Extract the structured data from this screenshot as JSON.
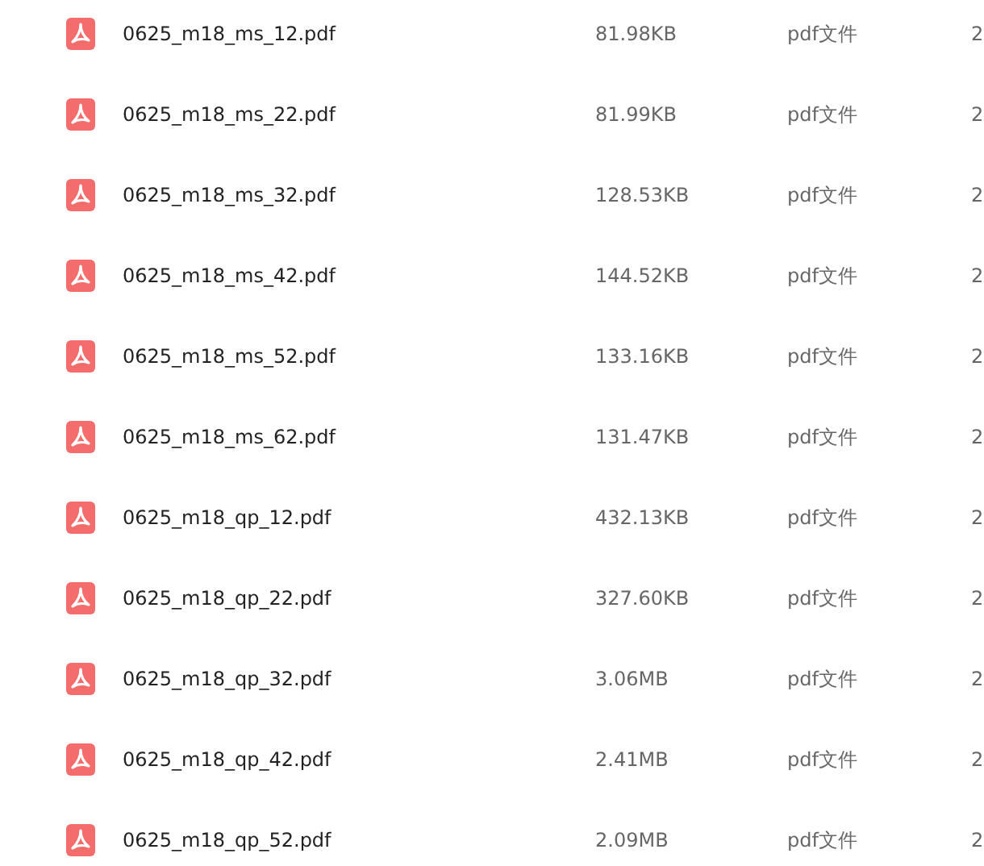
{
  "files": [
    {
      "name": "0625_m18_ms_12.pdf",
      "size": "81.98KB",
      "type": "pdf文件",
      "column_4": "2"
    },
    {
      "name": "0625_m18_ms_22.pdf",
      "size": "81.99KB",
      "type": "pdf文件",
      "column_4": "2"
    },
    {
      "name": "0625_m18_ms_32.pdf",
      "size": "128.53KB",
      "type": "pdf文件",
      "column_4": "2"
    },
    {
      "name": "0625_m18_ms_42.pdf",
      "size": "144.52KB",
      "type": "pdf文件",
      "column_4": "2"
    },
    {
      "name": "0625_m18_ms_52.pdf",
      "size": "133.16KB",
      "type": "pdf文件",
      "column_4": "2"
    },
    {
      "name": "0625_m18_ms_62.pdf",
      "size": "131.47KB",
      "type": "pdf文件",
      "column_4": "2"
    },
    {
      "name": "0625_m18_qp_12.pdf",
      "size": "432.13KB",
      "type": "pdf文件",
      "column_4": "2"
    },
    {
      "name": "0625_m18_qp_22.pdf",
      "size": "327.60KB",
      "type": "pdf文件",
      "column_4": "2"
    },
    {
      "name": "0625_m18_qp_32.pdf",
      "size": "3.06MB",
      "type": "pdf文件",
      "column_4": "2"
    },
    {
      "name": "0625_m18_qp_42.pdf",
      "size": "2.41MB",
      "type": "pdf文件",
      "column_4": "2"
    },
    {
      "name": "0625_m18_qp_52.pdf",
      "size": "2.09MB",
      "type": "pdf文件",
      "column_4": "2"
    }
  ]
}
